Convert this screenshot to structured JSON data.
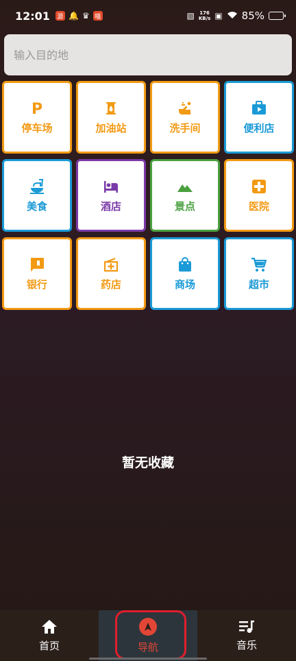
{
  "status": {
    "time": "12:01",
    "network_speed_value": "176",
    "network_speed_unit": "KB/s",
    "battery_percent": "85%",
    "battery_level": 0.85
  },
  "search": {
    "placeholder": "输入目的地"
  },
  "categories": [
    {
      "label": "停车场",
      "icon": "parking-icon",
      "color": "#f29a14"
    },
    {
      "label": "加油站",
      "icon": "gas-station-icon",
      "color": "#f29a14"
    },
    {
      "label": "洗手间",
      "icon": "restroom-icon",
      "color": "#f29a14"
    },
    {
      "label": "便利店",
      "icon": "convenience-store-icon",
      "color": "#1a9ad6"
    },
    {
      "label": "美食",
      "icon": "food-icon",
      "color": "#1a9ad6"
    },
    {
      "label": "酒店",
      "icon": "hotel-icon",
      "color": "#7a3aa8"
    },
    {
      "label": "景点",
      "icon": "scenic-spot-icon",
      "color": "#4aa040"
    },
    {
      "label": "医院",
      "icon": "hospital-icon",
      "color": "#f29a14"
    },
    {
      "label": "银行",
      "icon": "bank-icon",
      "color": "#f29a14"
    },
    {
      "label": "药店",
      "icon": "pharmacy-icon",
      "color": "#f29a14"
    },
    {
      "label": "商场",
      "icon": "shopping-mall-icon",
      "color": "#1a9ad6"
    },
    {
      "label": "超市",
      "icon": "supermarket-icon",
      "color": "#1a9ad6"
    }
  ],
  "favorites": {
    "empty_text": "暂无收藏"
  },
  "nav": {
    "home": "首页",
    "navigate": "导航",
    "music": "音乐",
    "active": "navigate"
  }
}
